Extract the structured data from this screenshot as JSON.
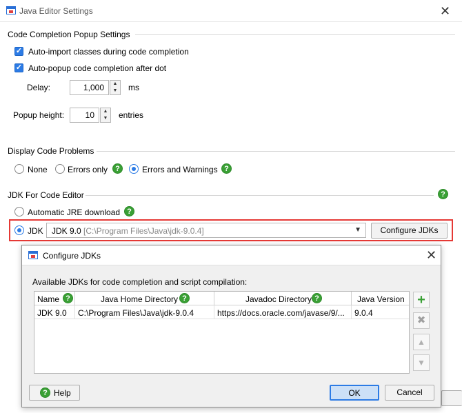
{
  "window": {
    "title": "Java Editor Settings",
    "close": "✕"
  },
  "completion": {
    "title": "Code Completion Popup Settings",
    "auto_import": "Auto-import classes during code completion",
    "auto_popup": "Auto-popup code completion after dot",
    "delay_label": "Delay:",
    "delay_value": "1,000",
    "delay_unit": "ms",
    "popup_label": "Popup height:",
    "popup_value": "10",
    "popup_unit": "entries"
  },
  "problems": {
    "title": "Display Code Problems",
    "none": "None",
    "errors_only": "Errors only",
    "errors_warnings": "Errors and Warnings",
    "selected": "errors_warnings"
  },
  "jdk": {
    "title": "JDK For Code Editor",
    "auto_jre": "Automatic JRE download",
    "jdk_label": "JDK",
    "combo_name": "JDK 9.0",
    "combo_path": "[C:\\Program Files\\Java\\jdk-9.0.4]",
    "configure_button": "Configure JDKs"
  },
  "dialog": {
    "title": "Configure JDKs",
    "close": "✕",
    "description": "Available JDKs for code completion and script compilation:",
    "columns": [
      "Name",
      "Java Home Directory",
      "Javadoc Directory",
      "Java Version"
    ],
    "rows": [
      {
        "name": "JDK 9.0",
        "home": "C:\\Program Files\\Java\\jdk-9.0.4",
        "javadoc": "https://docs.oracle.com/javase/9/...",
        "version": "9.0.4"
      }
    ],
    "help_button": "Help",
    "ok_button": "OK",
    "cancel_button": "Cancel"
  },
  "icons": {
    "help": "?",
    "add": "+",
    "remove": "✖",
    "up": "▲",
    "down": "▼"
  },
  "colors": {
    "accent": "#2c7be5",
    "help_green": "#3aa035",
    "highlight_red": "#e53935"
  }
}
